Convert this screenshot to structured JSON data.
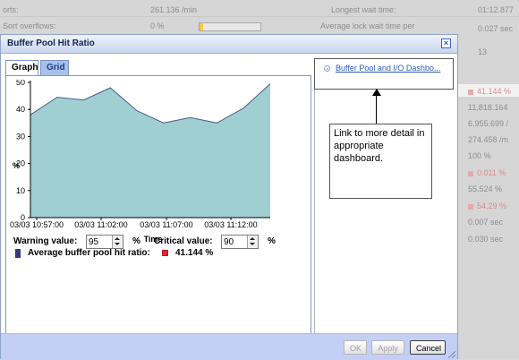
{
  "background": {
    "rows": [
      {
        "left_label": "orts:",
        "left_value": "261.136 /min",
        "right_label": "Longest wait time:",
        "right_value": "01:12.877"
      },
      {
        "left_label": "Sort overflows:",
        "left_value": "0 %",
        "right_label": "Average lock wait time per",
        "right_value": "0.027 sec"
      },
      {
        "right_value": "13"
      }
    ],
    "column_values": [
      {
        "value": "41.144 %",
        "alert": true
      },
      {
        "value": "11,818.164",
        "alert": false
      },
      {
        "value": "6,955.699 /",
        "alert": false
      },
      {
        "value": "274.458 /m",
        "alert": false
      },
      {
        "value": "100 %",
        "alert": false
      },
      {
        "value": "0.011 %",
        "alert": true
      },
      {
        "value": "55.524 %",
        "alert": false
      },
      {
        "value": "54.29 %",
        "alert": true
      },
      {
        "value": "0.007 sec",
        "alert": false
      },
      {
        "value": "0.030 sec",
        "alert": false
      }
    ]
  },
  "dialog": {
    "title": "Buffer Pool Hit Ratio",
    "close_icon": "close-icon",
    "tabs": [
      {
        "label": "Graph",
        "active": true
      },
      {
        "label": "Grid",
        "active": false
      }
    ],
    "link_text": "Buffer Pool and I/O Dashbo...",
    "callout_text": "Link to more detail in appropriate dashboard.",
    "legend": {
      "label": "Average buffer pool hit ratio:",
      "value": "41.144 %"
    },
    "warning": {
      "label": "Warning value:",
      "value": "95",
      "unit": "%"
    },
    "critical": {
      "label": "Critical value:",
      "value": "90",
      "unit": "%"
    },
    "buttons": {
      "ok": "OK",
      "apply": "Apply",
      "cancel": "Cancel"
    },
    "colors": {
      "area_fill": "#a0cfd1",
      "area_line": "#4c5a93",
      "alert_red": "#e0282e",
      "footer": "#c4cff5"
    }
  },
  "chart_data": {
    "type": "area",
    "x": [
      "10:55",
      "10:58",
      "11:01",
      "11:04",
      "11:07",
      "11:10",
      "11:13",
      "11:16",
      "11:19"
    ],
    "values": [
      38,
      44.5,
      43.5,
      48,
      39.5,
      35,
      37,
      35,
      40.5,
      49.5
    ],
    "x_ticks": [
      "03/03 10:57:00",
      "03/03 11:02:00",
      "03/03 11:07:00",
      "03/03 11:12:00"
    ],
    "ylabel": "%",
    "xlabel": "Time",
    "ylim": [
      0,
      50
    ],
    "yticks": [
      0,
      10,
      20,
      30,
      40,
      50
    ],
    "grid": false
  }
}
